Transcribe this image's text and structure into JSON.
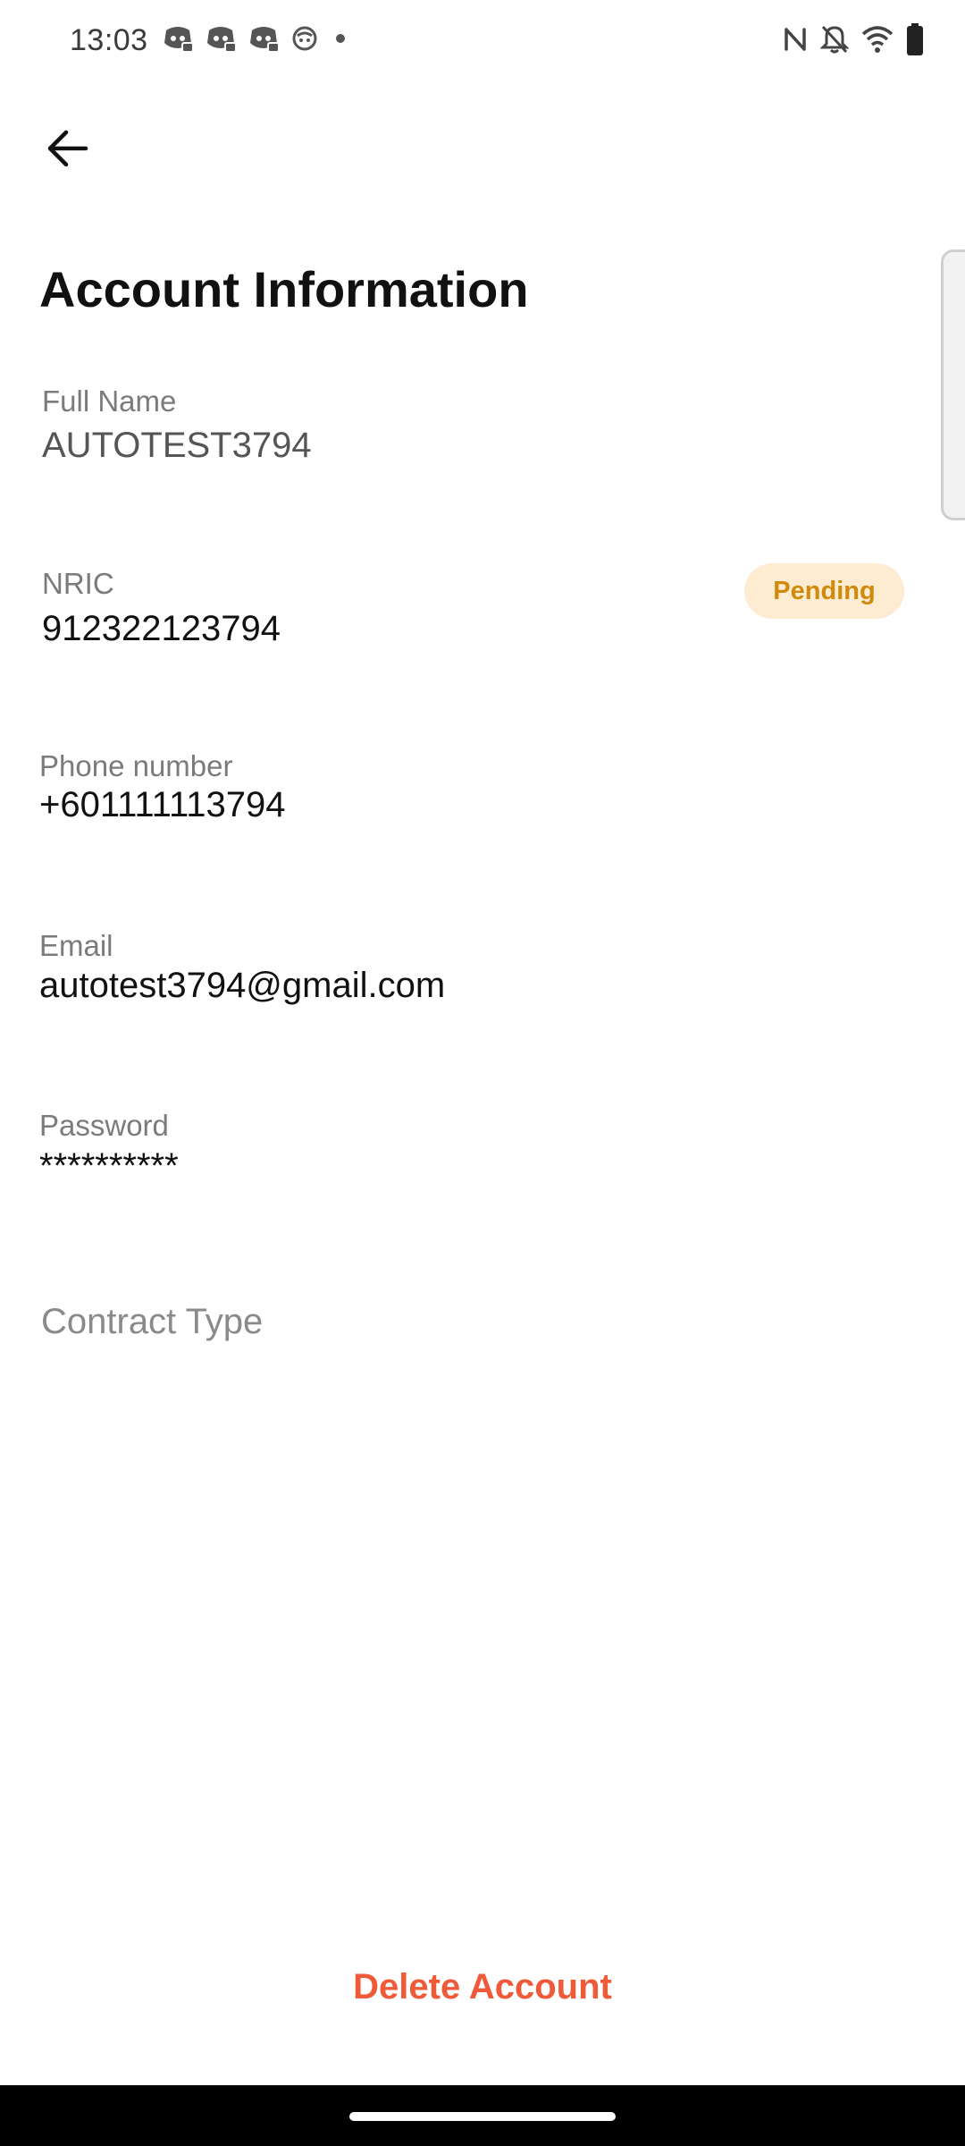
{
  "status_bar": {
    "time": "13:03",
    "notification_icons": [
      "discord-icon",
      "discord-icon",
      "discord-icon",
      "cat-app-icon",
      "dot-icon"
    ],
    "system_icons": [
      "nfc-icon",
      "bell-off-icon",
      "wifi-icon",
      "battery-icon"
    ]
  },
  "header": {
    "back_icon": "arrow-left-icon",
    "title": "Account Information"
  },
  "fields": {
    "full_name": {
      "label": "Full Name",
      "value": "AUTOTEST3794"
    },
    "nric": {
      "label": "NRIC",
      "value": "912322123794",
      "status": "Pending"
    },
    "phone": {
      "label": "Phone number",
      "value": "+601111113794"
    },
    "email": {
      "label": "Email",
      "value": "autotest3794@gmail.com"
    },
    "password": {
      "label": "Password",
      "value": "**********"
    }
  },
  "contract_type": {
    "label": "Contract Type"
  },
  "actions": {
    "delete_label": "Delete Account"
  },
  "colors": {
    "accent_delete": "#ef5a38",
    "badge_bg": "#fdecd2",
    "badge_text": "#d08a0c",
    "label_gray": "#7b7b7b"
  }
}
